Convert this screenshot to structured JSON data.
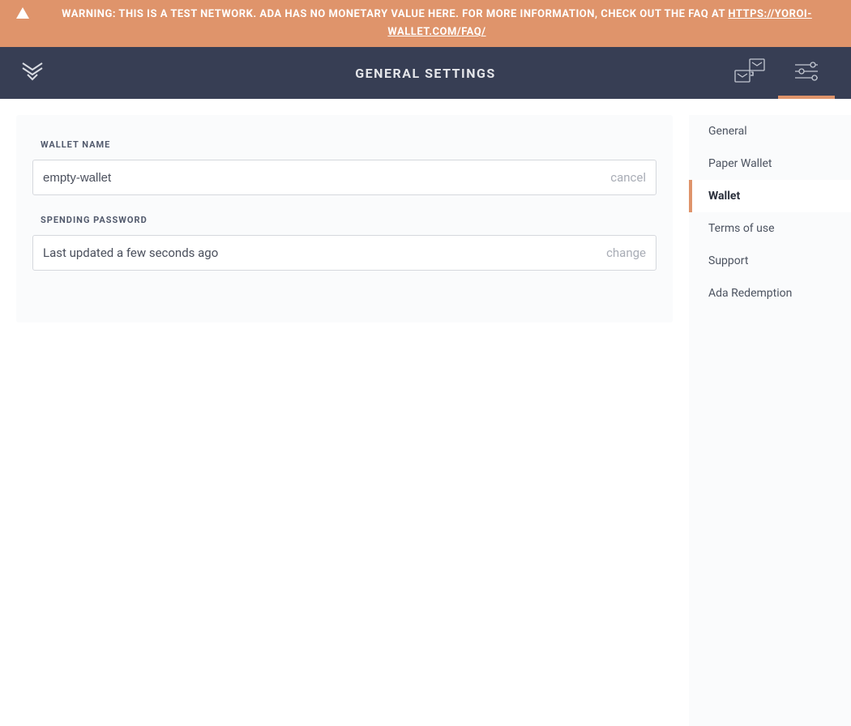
{
  "warning": {
    "text": "WARNING: THIS IS A TEST NETWORK. ADA HAS NO MONETARY VALUE HERE. FOR MORE INFORMATION, CHECK OUT THE FAQ AT ",
    "link_text": "HTTPS://YOROI-WALLET.COM/FAQ/"
  },
  "header": {
    "title": "GENERAL SETTINGS"
  },
  "icons": {
    "logo": "yoroi-logo",
    "wallets": "wallets-stack-icon",
    "settings": "settings-sliders-icon"
  },
  "fields": {
    "wallet_name": {
      "label": "WALLET NAME",
      "value": "empty-wallet",
      "action": "cancel"
    },
    "spending_password": {
      "label": "SPENDING PASSWORD",
      "value": "Last updated a few seconds ago",
      "action": "change"
    }
  },
  "sidebar": {
    "items": [
      {
        "label": "General",
        "active": false
      },
      {
        "label": "Paper Wallet",
        "active": false
      },
      {
        "label": "Wallet",
        "active": true
      },
      {
        "label": "Terms of use",
        "active": false
      },
      {
        "label": "Support",
        "active": false
      },
      {
        "label": "Ada Redemption",
        "active": false
      }
    ]
  }
}
